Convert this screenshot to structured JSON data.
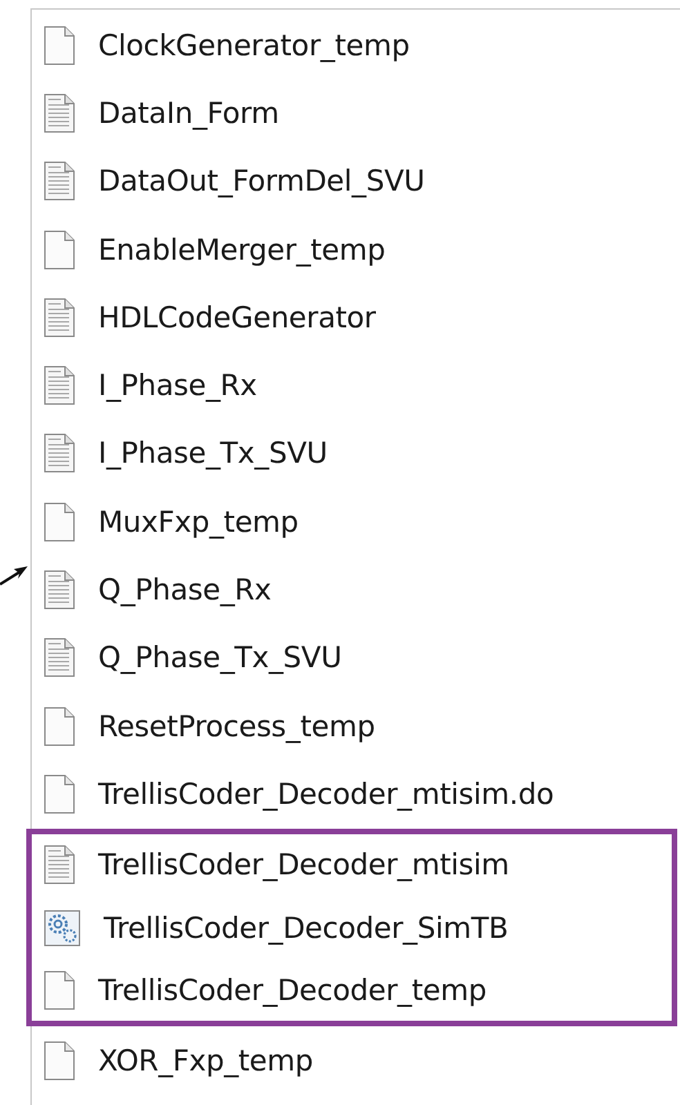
{
  "files": [
    {
      "name": "ClockGenerator_temp",
      "kind": "blank",
      "highlighted": false
    },
    {
      "name": "DataIn_Form",
      "kind": "text",
      "highlighted": false
    },
    {
      "name": "DataOut_FormDel_SVU",
      "kind": "text",
      "highlighted": false
    },
    {
      "name": "EnableMerger_temp",
      "kind": "blank",
      "highlighted": false
    },
    {
      "name": "HDLCodeGenerator",
      "kind": "text",
      "highlighted": false
    },
    {
      "name": "I_Phase_Rx",
      "kind": "text",
      "highlighted": false
    },
    {
      "name": "I_Phase_Tx_SVU",
      "kind": "text",
      "highlighted": false
    },
    {
      "name": "MuxFxp_temp",
      "kind": "blank",
      "highlighted": false
    },
    {
      "name": "Q_Phase_Rx",
      "kind": "text",
      "highlighted": false,
      "pointed": true
    },
    {
      "name": "Q_Phase_Tx_SVU",
      "kind": "text",
      "highlighted": false
    },
    {
      "name": "ResetProcess_temp",
      "kind": "blank",
      "highlighted": false
    },
    {
      "name": "TrellisCoder_Decoder_mtisim.do",
      "kind": "blank",
      "highlighted": false
    },
    {
      "name": "TrellisCoder_Decoder_mtisim",
      "kind": "text",
      "highlighted": true
    },
    {
      "name": "TrellisCoder_Decoder_SimTB",
      "kind": "gear",
      "highlighted": true
    },
    {
      "name": "TrellisCoder_Decoder_temp",
      "kind": "blank",
      "highlighted": true
    },
    {
      "name": "XOR_Fxp_temp",
      "kind": "blank",
      "highlighted": false
    }
  ]
}
